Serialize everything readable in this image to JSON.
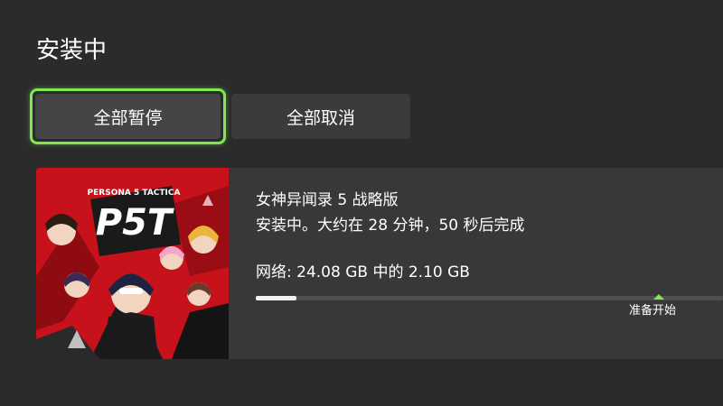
{
  "page": {
    "title": "安装中"
  },
  "actions": {
    "pause_all_label": "全部暂停",
    "cancel_all_label": "全部取消"
  },
  "install_item": {
    "game_title": "女神异闻录 5  战略版",
    "status": "安装中。大约在 28 分钟，50 秒后完成",
    "network_progress": "网络: 24.08 GB 中的 2.10 GB",
    "downloaded_gb": 2.1,
    "total_gb": 24.08,
    "ready_to_start_label": "准备开始",
    "cover_art": {
      "logo_lettering": "P5T",
      "logo_subtitle": "PERSONA 5 TACTICA"
    }
  },
  "colors": {
    "background": "#2b2b2b",
    "focus_ring": "#7ee94f",
    "button": "#3b3b3b",
    "card": "#383838",
    "progress_fill": "#f2f2f2",
    "progress_track": "#505050",
    "cover_red": "#c8121b"
  }
}
